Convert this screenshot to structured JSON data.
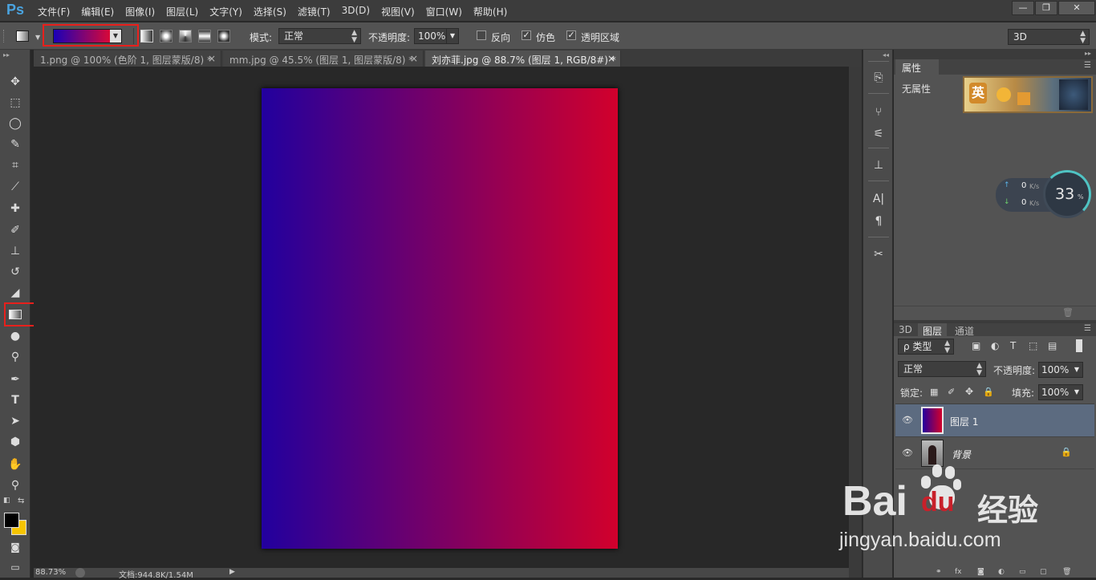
{
  "app": {
    "logo": "Ps",
    "menu": [
      "文件(F)",
      "编辑(E)",
      "图像(I)",
      "图层(L)",
      "文字(Y)",
      "选择(S)",
      "滤镜(T)",
      "3D(D)",
      "视图(V)",
      "窗口(W)",
      "帮助(H)"
    ],
    "window_controls": {
      "minimize": "—",
      "restore": "❐",
      "close": "✕"
    }
  },
  "options": {
    "mode_label": "模式:",
    "mode_value": "正常",
    "opacity_label": "不透明度:",
    "opacity_value": "100%",
    "reverse_label": "反向",
    "dither_label": "仿色",
    "transparency_label": "透明区域",
    "workspace_value": "3D",
    "gradient_from": "#1a00b8",
    "gradient_to": "#ff0a1e"
  },
  "tabs": [
    {
      "label": "1.png @ 100% (色阶 1, 图层蒙版/8) *",
      "close": "×"
    },
    {
      "label": "mm.jpg @ 45.5% (图层 1, 图层蒙版/8) *",
      "close": "×"
    },
    {
      "label": "刘亦菲.jpg @ 88.7% (图层 1, RGB/8#) *",
      "close": "×"
    }
  ],
  "canvas": {
    "gradient_from": "#22009e",
    "gradient_to": "#d2002c"
  },
  "status": {
    "zoom": "88.73%",
    "doc": "文档:944.8K/1.54M"
  },
  "properties": {
    "tab": "属性",
    "no_properties": "无属性"
  },
  "net_widget": {
    "up": "0",
    "down": "0",
    "unit": "K/s",
    "percent": "33",
    "percent_sign": "%"
  },
  "layers_panel": {
    "tabs": [
      "3D",
      "图层",
      "通道"
    ],
    "filter_label": "ρ 类型",
    "blend_value": "正常",
    "opacity_label": "不透明度:",
    "opacity_value": "100%",
    "lock_label": "锁定:",
    "fill_label": "填充:",
    "fill_value": "100%",
    "layers": [
      {
        "name": "图层 1"
      },
      {
        "name": "背景"
      }
    ]
  },
  "watermark": {
    "brand": "Bai",
    "brand2": "du",
    "cn": "经验",
    "url": "jingyan.baidu.com"
  }
}
